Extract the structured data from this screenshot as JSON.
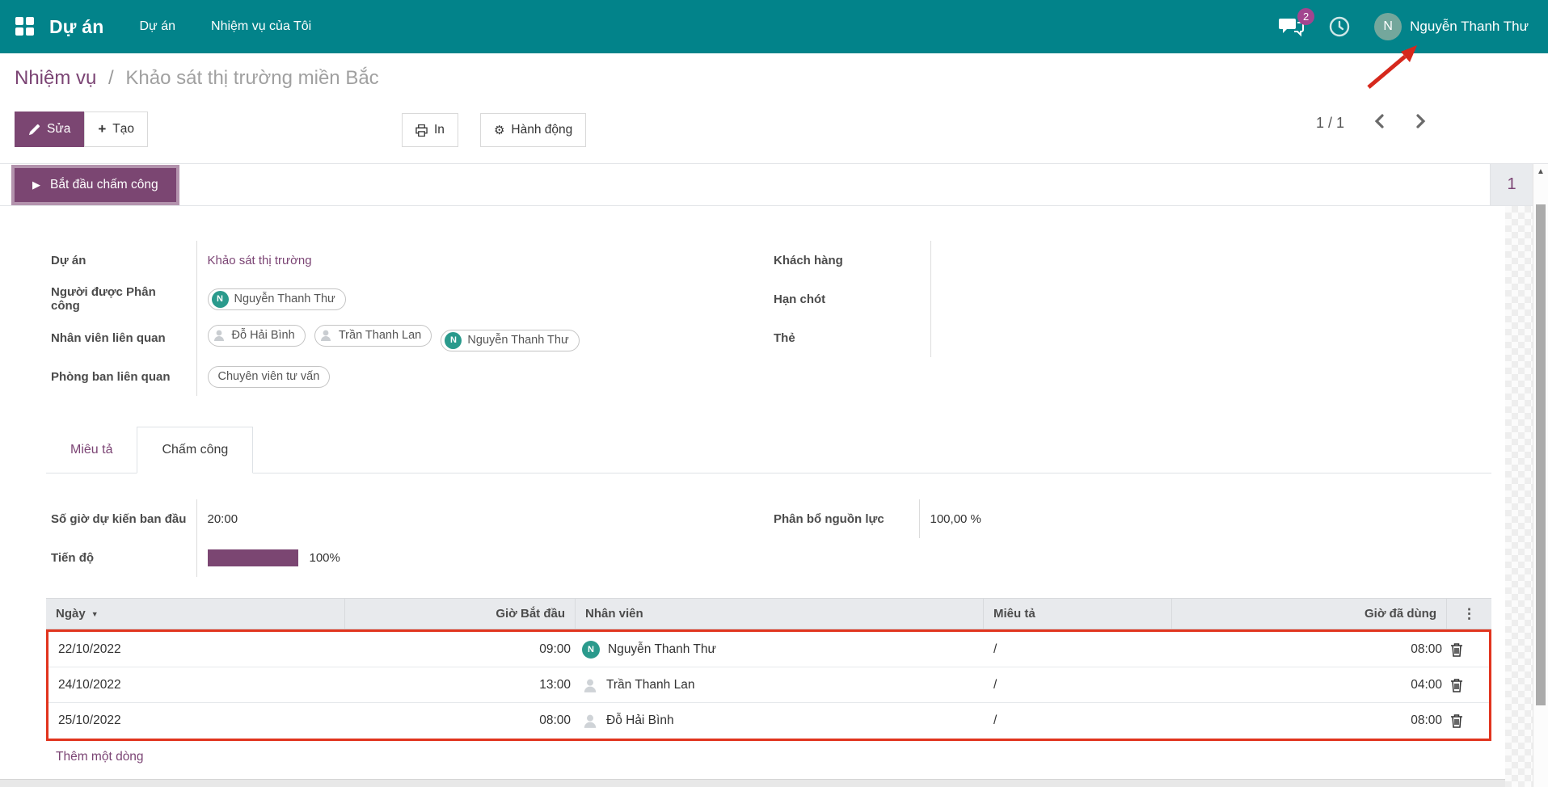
{
  "navbar": {
    "brand": "Dự án",
    "menu": [
      {
        "label": "Dự án"
      },
      {
        "label": "Nhiệm vụ của Tôi"
      }
    ],
    "messages_badge": "2",
    "user": {
      "initial": "N",
      "name": "Nguyễn Thanh Thư"
    }
  },
  "breadcrumb": {
    "parent": "Nhiệm vụ",
    "separator": "/",
    "current": "Khảo sát thị trường miền Bắc"
  },
  "controls": {
    "edit": "Sửa",
    "create": "Tạo",
    "print": "In",
    "action": "Hành động",
    "pager": "1 / 1"
  },
  "statbar": {
    "start_timesheet": "Bắt đầu chấm công",
    "stat_count": "1"
  },
  "form": {
    "project": {
      "label": "Dự án",
      "value": "Khảo sát thị trường"
    },
    "assignee": {
      "label": "Người được Phân công",
      "tag": {
        "initial": "N",
        "name": "Nguyễn Thanh Thư"
      }
    },
    "related_employees": {
      "label": "Nhân viên liên quan",
      "tags": [
        {
          "icon": "person",
          "name": "Đỗ Hải Bình"
        },
        {
          "icon": "person",
          "name": "Trần Thanh Lan"
        },
        {
          "icon": "avatar",
          "initial": "N",
          "name": "Nguyễn Thanh Thư"
        }
      ]
    },
    "related_department": {
      "label": "Phòng ban liên quan",
      "tags": [
        {
          "name": "Chuyên viên tư vấn"
        }
      ]
    },
    "customer": {
      "label": "Khách hàng",
      "value": ""
    },
    "deadline": {
      "label": "Hạn chót",
      "value": ""
    },
    "tags_field": {
      "label": "Thẻ",
      "value": ""
    }
  },
  "tabs": [
    {
      "label": "Miêu tả"
    },
    {
      "label": "Chấm công"
    }
  ],
  "timesheet_tab": {
    "planned_hours": {
      "label": "Số giờ dự kiến ban đầu",
      "value": "20:00"
    },
    "progress": {
      "label": "Tiến độ",
      "percent": 100,
      "text": "100%"
    },
    "allocation": {
      "label": "Phân bổ nguồn lực",
      "value": "100,00 %"
    }
  },
  "table": {
    "headers": [
      "Ngày",
      "Giờ Bắt đầu",
      "Nhân viên",
      "Miêu tả",
      "Giờ đã dùng"
    ],
    "rows": [
      {
        "date": "22/10/2022",
        "start": "09:00",
        "avatar": "initial",
        "initial": "N",
        "employee": "Nguyễn Thanh Thư",
        "description": "/",
        "duration": "08:00"
      },
      {
        "date": "24/10/2022",
        "start": "13:00",
        "avatar": "person",
        "initial": "",
        "employee": "Trần Thanh Lan",
        "description": "/",
        "duration": "04:00"
      },
      {
        "date": "25/10/2022",
        "start": "08:00",
        "avatar": "person",
        "initial": "",
        "employee": "Đỗ Hải Bình",
        "description": "/",
        "duration": "08:00"
      }
    ],
    "add_line": "Thêm một dòng"
  },
  "icons": {
    "kebab": "⋮",
    "sort_desc": "▼",
    "plus": "+",
    "gear": "⚙",
    "play": "▶",
    "scroll_up": "▲"
  },
  "colors": {
    "navbar_teal": "#02838a",
    "accent_purple": "#7b4672",
    "tag_teal": "#2a9a8c",
    "annotation_red": "#e1341e",
    "badge_purple": "#a2458f"
  }
}
